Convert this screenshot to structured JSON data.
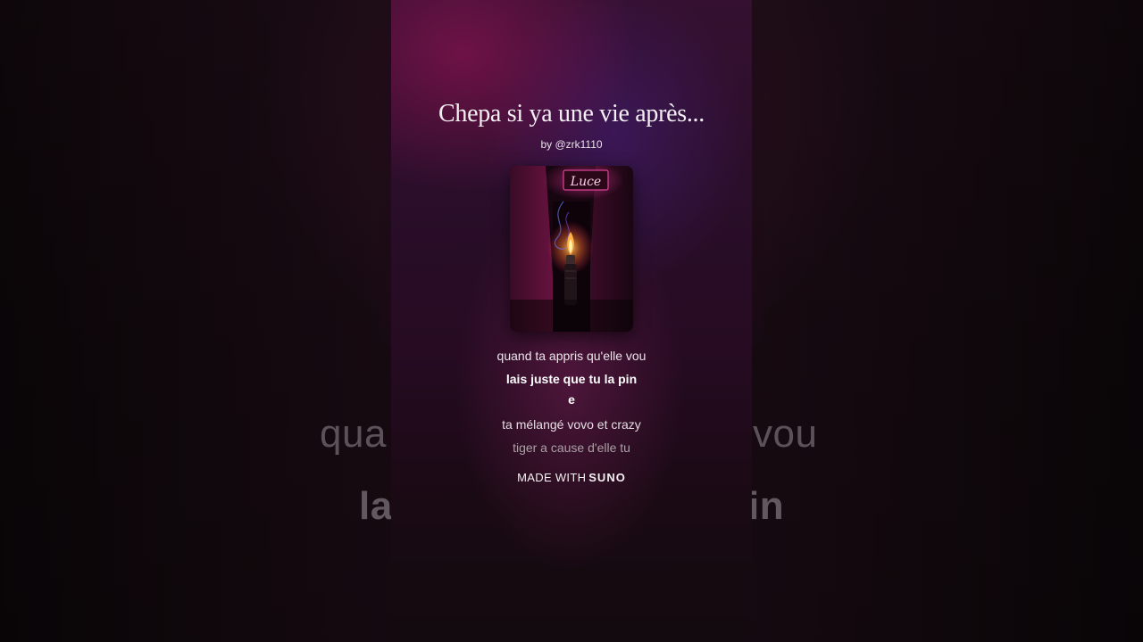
{
  "song": {
    "title": "Chepa si ya une vie après...",
    "artist": "by @zrk1110",
    "cover_sign": "Luce"
  },
  "lyrics": {
    "line1": "quand ta appris qu'elle vou",
    "line2": "lais juste que tu la pin",
    "line3": "e",
    "line4": "ta mélangé vovo et crazy",
    "line5": "tiger a cause d'elle tu"
  },
  "background_lyrics": {
    "line1_left": "qua",
    "line1_right": "vou",
    "line2_left": "la",
    "line2_right": "in"
  },
  "footer": {
    "made_with": "MADE WITH",
    "brand": "SUNO"
  },
  "colors": {
    "accent_pink": "#e0349a",
    "panel_top": "#351030",
    "panel_bottom": "#120a0e"
  }
}
